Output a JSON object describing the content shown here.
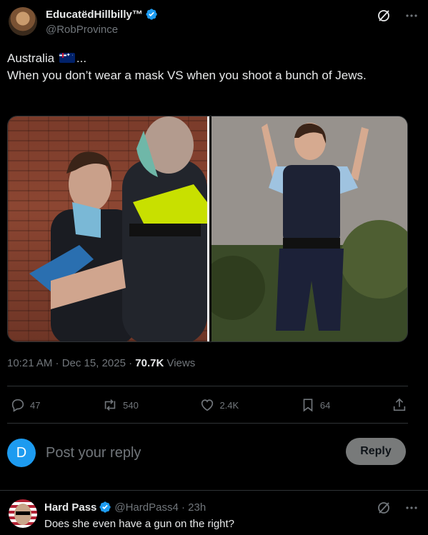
{
  "post": {
    "author_name": "EducatëdHillbilly™",
    "author_handle": "@RobProvince",
    "text_line1_prefix": "Australia",
    "text_line1_suffix": "...",
    "text_line2": "When you don’t wear a mask VS when you shoot a bunch of Jews.",
    "timestamp": "10:21 AM · Dec 15, 2025 · ",
    "views_count": "70.7K",
    "views_label": " Views",
    "stats": {
      "replies": "47",
      "reposts": "540",
      "likes": "2.4K",
      "bookmarks": "64"
    }
  },
  "composer": {
    "avatar_letter": "D",
    "placeholder": "Post your reply",
    "reply_button": "Reply"
  },
  "reply": {
    "name": "Hard Pass",
    "handle_time": "@HardPass4 · 23h",
    "text": "Does she even have a gun on the right?"
  },
  "colors": {
    "background": "#000000",
    "text_primary": "#e7e9ea",
    "text_secondary": "#71767b",
    "verified_blue": "#1d9bf0",
    "border": "#2f3336"
  }
}
